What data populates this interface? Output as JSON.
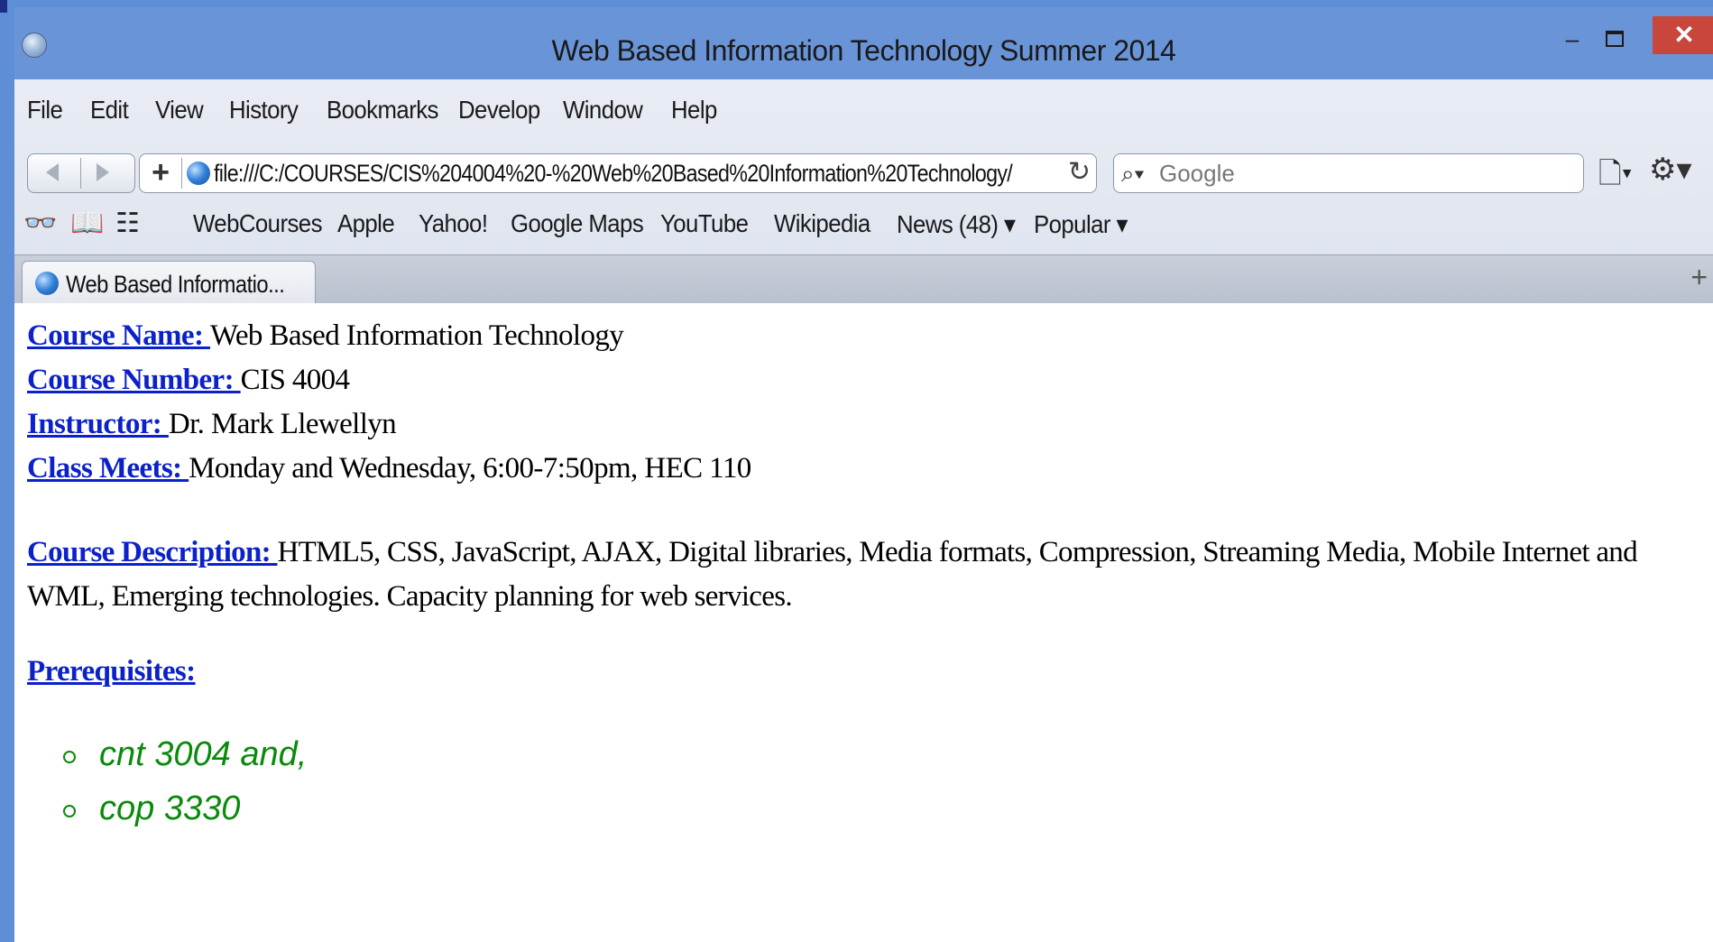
{
  "window": {
    "title": "Web Based Information Technology Summer 2014",
    "minimize": "–",
    "close": "✕"
  },
  "menu": [
    "File",
    "Edit",
    "View",
    "History",
    "Bookmarks",
    "Develop",
    "Window",
    "Help"
  ],
  "navbar": {
    "add_button": "+",
    "url": "file:///C:/COURSES/CIS%204004%20-%20Web%20Based%20Information%20Technology/",
    "reload": "↻",
    "search_placeholder": "Google"
  },
  "bookmarks": [
    "WebCourses",
    "Apple",
    "Yahoo!",
    "Google Maps",
    "YouTube",
    "Wikipedia",
    "News (48) ▾",
    "Popular ▾"
  ],
  "tab": {
    "label": "Web Based Informatio...",
    "new_tab": "+"
  },
  "page": {
    "course_name_label": "Course Name: ",
    "course_name": "Web Based Information Technology",
    "course_number_label": "Course Number: ",
    "course_number": "CIS 4004",
    "instructor_label": "Instructor: ",
    "instructor": "Dr. Mark Llewellyn",
    "class_meets_label": "Class Meets: ",
    "class_meets": "Monday and Wednesday, 6:00-7:50pm, HEC 110",
    "description_label": "Course Description: ",
    "description": "HTML5, CSS, JavaScript, AJAX, Digital libraries, Media formats, Compression, Streaming Media, Mobile Internet and WML, Emerging technologies. Capacity planning for web services.",
    "prerequisites_label": "Prerequisites:",
    "prerequisites": [
      "cnt 3004 and,",
      "cop 3330"
    ]
  },
  "colors": {
    "link_blue": "#0b21c9",
    "prereq_green": "#0a8a0a",
    "titlebar": "#6a94d8",
    "close_red": "#c9463d"
  }
}
